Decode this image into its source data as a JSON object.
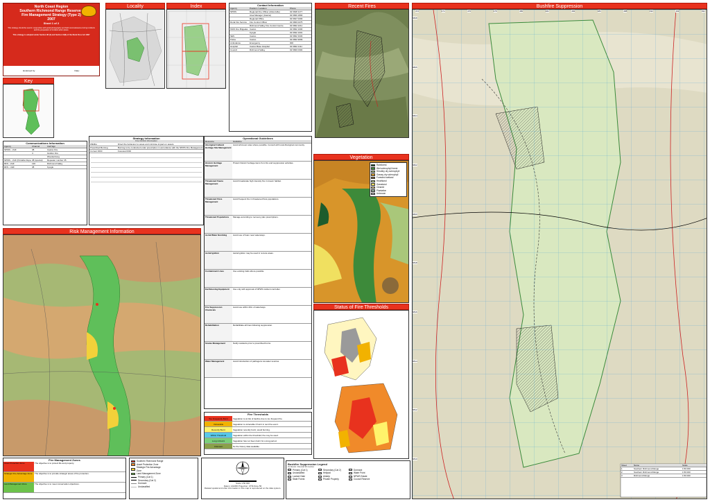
{
  "title_block": {
    "line1": "North Coast Region",
    "line2": "Southern Richmond Range Reserves",
    "line3": "Fire Management Strategy (Type 2)",
    "line4": "2007",
    "line5": "Sheet 1 of 2",
    "body": "This strategy should be used in conjunction with aerial photography and field reconnaissance during incidents and the preparation of incident action plans.",
    "endorsed": "This strategy is adopted under Section 38 (4) and Section 44(3) of the Rural Fires Act 1997",
    "endorsed_by": "Endorsed by:",
    "date_label": "Date:"
  },
  "panels": {
    "locality": "Locality",
    "index": "Index",
    "recent_fires": "Recent Fires",
    "bushfire_suppression": "Bushfire Suppression",
    "key": "Key",
    "risk_management": "Risk Management Information",
    "vegetation": "Vegetation",
    "fire_thresholds": "Status of Fire Thresholds"
  },
  "communications": {
    "title": "Communications Information",
    "headers": [
      "Agency",
      "Channel",
      "Call Sign"
    ],
    "rows": [
      [
        "NPWS - VHF",
        "38",
        "Casino Fire"
      ],
      [
        "",
        "4",
        "Grafton Fire"
      ],
      [
        "",
        "",
        "Woodenbong"
      ],
      [
        "NPWS - VHF (Portable Repeater)",
        "38 (special)",
        "Repeater number 35"
      ],
      [
        "RFS - VHF",
        "130",
        "Richmond Valley"
      ],
      [
        "RFS - UHF",
        "38",
        "Kyogle"
      ]
    ]
  },
  "strategy": {
    "title": "Strategy Information",
    "subtitle": "Fire Control Information",
    "rows": [
      [
        "Wildfire",
        "Direct fire behaviour to areas and minimise impact on assets."
      ],
      [
        "Prescribed Burning",
        "Burning to be conducted under prescription in accordance with the NPWS Fire Management Manual."
      ],
      [
        "Current FFDI",
        "Forecast FFDI"
      ]
    ]
  },
  "contacts": {
    "title": "Contact Information",
    "headers": [
      "Agency",
      "Position / Location",
      "Phone"
    ],
    "rows": [
      [
        "NPWS",
        "Regional Fire Officer (Alstonville)",
        "02 6628 1177"
      ],
      [
        "",
        "Area Manager (Casino)",
        "02 6660 1800"
      ],
      [
        "",
        "Regional Office",
        "02 6627 0200"
      ],
      [
        "Rural Fire Service",
        "Fire Control Officer",
        "02 6660 0275"
      ],
      [
        "",
        "Richmond Valley Fire Control Centre",
        "02 6662 2211"
      ],
      [
        "NSW Fire Brigades",
        "Casino",
        "02 6662 1000"
      ],
      [
        "",
        "Kyogle",
        "02 6632 1001"
      ],
      [
        "SES",
        "Casino",
        "02 6662 3333"
      ],
      [
        "Police",
        "Casino",
        "02 6662 9099"
      ],
      [
        "Ambulance",
        "Emergency",
        "000"
      ],
      [
        "Hospital",
        "Casino Base Hospital",
        "02 6662 2111"
      ],
      [
        "Council",
        "Richmond Valley",
        "02 6660 0300"
      ]
    ]
  },
  "operational": {
    "title": "Operational Guidelines",
    "headers": [
      "Resource",
      "Guideline"
    ],
    "rows": [
      [
        "Aboriginal Cultural Heritage Site Management",
        "Avoid all known sites where possible. Consult with local Aboriginal community."
      ],
      [
        "Historic Heritage Management",
        "Protect historic heritage items from fire and suppression activities."
      ],
      [
        "Threatened Fauna Management",
        "Avoid broadscale high intensity fire in known habitat."
      ],
      [
        "Threatened Flora Management",
        "Avoid frequent fire in threatened flora populations."
      ],
      [
        "Threatened Populations",
        "Manage according to recovery plan prescriptions."
      ],
      [
        "Aerial Water Bombing",
        "Avoid use of foam near waterways."
      ],
      [
        "Aerial Ignition",
        "Aerial ignition may be used in remote areas."
      ],
      [
        "Containment Lines",
        "Use existing trails where possible."
      ],
      [
        "Earthmoving Equipment",
        "Use only with approval of NPWS incident controller."
      ],
      [
        "Fire Suppression Chemicals",
        "Avoid use within 20m of waterways."
      ],
      [
        "Rehabilitation",
        "Rehabilitate all lines following suppression."
      ],
      [
        "Smoke Management",
        "Notify residents prior to prescribed burns."
      ],
      [
        "Water Management",
        "Avoid introduction of pathogens via water sources."
      ]
    ]
  },
  "thresholds": {
    "title": "Fire Thresholds",
    "rows": [
      [
        "Too Frequently Burnt",
        "#e8321e",
        "Vegetation is at risk of decline due to too frequent fire."
      ],
      [
        "Vulnerable",
        "#f2b200",
        "Vegetation is vulnerable if burnt in next fire event."
      ],
      [
        "Recently Burnt",
        "#fff36b",
        "Vegetation recently burnt; avoid burning."
      ],
      [
        "Within Threshold",
        "#59c8e8",
        "Vegetation within the threshold; fire may be used."
      ],
      [
        "Long Unburnt",
        "#7ad07a",
        "Vegetation has not been burnt for a long period."
      ],
      [
        "Unknown",
        "#8aa04a",
        "No fire history data available."
      ]
    ]
  },
  "fire_mgmt_zones": {
    "title": "Fire Management Zones",
    "rows": [
      [
        "Asset Protection Zone",
        "#e8321e",
        "The objective is to protect life and property."
      ],
      [
        "Strategic Fire Advantage Zone",
        "#f2b200",
        "The objective is to provide strategic areas of fire protection."
      ],
      [
        "Land Management Zone",
        "#6cc24a",
        "The objective is to meet conservation objectives."
      ]
    ]
  },
  "legend_small": {
    "items": [
      [
        "Southern Richmond Range",
        "#e8321e"
      ],
      [
        "Asset Protection Zone",
        "#f08a2a"
      ],
      [
        "Strategic Fire Advantage Zone",
        "#f2d13a"
      ],
      [
        "Land Management Zone",
        "#6cc24a"
      ]
    ],
    "lines": [
      [
        "Primary (Cat 1)",
        "#000000"
      ],
      [
        "Secondary (Cat 2)",
        "#000000"
      ],
      [
        "Dormant",
        "#888888"
      ],
      [
        "Unclassified",
        "#bbbbbb"
      ]
    ]
  },
  "vegetation_legend": [
    [
      "Rainforest",
      "#1d5c2c"
    ],
    [
      "Wet sclerophyll forest",
      "#3d8a3a"
    ],
    [
      "Shrubby dry sclerophyll",
      "#a9c77a"
    ],
    [
      "Grassy dry sclerophyll",
      "#d69a2c"
    ],
    [
      "Forested wetland",
      "#8a6a3a"
    ],
    [
      "Heathland",
      "#c8e098"
    ],
    [
      "Grassland",
      "#f0e060"
    ],
    [
      "Cleared",
      "#e8d090"
    ],
    [
      "Plantation",
      "#8aa090"
    ],
    [
      "Unknown",
      "#c0c0c0"
    ]
  ],
  "suppression_legend": {
    "title": "Bushfire Suppression Legend",
    "subtitle": "Contours: Interval 10 metres",
    "items": [
      "Primary (Cat 1)",
      "Secondary (Cat 2)",
      "Dormant",
      "Unclassified",
      "Helipad",
      "Water Point",
      "Locked Gate",
      "Airstrip",
      "NPWS Estate",
      "State Forest",
      "Private Property",
      "Council Reserve"
    ]
  },
  "scale": {
    "text": "Scale 1:50 000",
    "note": "Datum: AGD66  Projection: UTM  Zone 56",
    "footer": "Related spatial and other information in this map is reproduced on the data system."
  },
  "grid": {
    "top": [
      "472",
      "474",
      "476",
      "478",
      "480",
      "482",
      "484",
      "486",
      "488",
      "490",
      "492",
      "494"
    ],
    "left": [
      "6828",
      "6826",
      "6824",
      "6822",
      "6820",
      "6818",
      "6816",
      "6814",
      "6812",
      "6810"
    ]
  },
  "sheet_table": {
    "headers": [
      "Sheet",
      "Name",
      "Scale"
    ],
    "rows": [
      [
        "1",
        "Southern Richmond Range",
        "1:50 000"
      ],
      [
        "2",
        "Southern Richmond Range",
        "1:50 000"
      ],
      [
        "3",
        "Richmond Range",
        "1:50 000"
      ]
    ]
  }
}
